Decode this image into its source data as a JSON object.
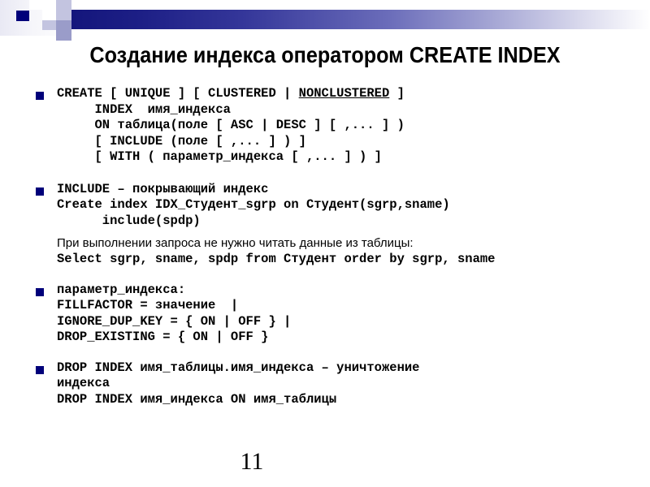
{
  "slide": {
    "title": "Создание индекса оператором CREATE INDEX",
    "page_number": "11",
    "accent_color": "#00007a",
    "bar_color_start": "#14167c",
    "bar_color_end": "#ffffff"
  },
  "blocks": {
    "create": {
      "line1_pre": "CREATE [ UNIQUE ] [ CLUSTERED | ",
      "line1_underlined": "NONCLUSTERED",
      "line1_post": " ]",
      "line2": "     INDEX  имя_индекса",
      "line3": "     ON таблица(поле [ ASC | DESC ] [ ,... ] )",
      "line4": "     [ INCLUDE (поле [ ,... ] ) ]",
      "line5": "     [ WITH ( параметр_индекса [ ,... ] ) ]"
    },
    "include": {
      "line1": "INCLUDE – покрывающий индекс",
      "line2": "Create index IDX_Студент_sgrp on Студент(sgrp,sname)",
      "line3": "      include(spdp)",
      "note": "При выполнении запроса не нужно читать данные из таблицы:",
      "line4": "Select sgrp, sname, spdp from Студент order by sgrp, sname"
    },
    "params": {
      "line1": "параметр_индекса:",
      "line2": "FILLFACTOR = значение  |",
      "line3": "IGNORE_DUP_KEY = { ON | OFF } |",
      "line4": "DROP_EXISTING = { ON | OFF }"
    },
    "drop": {
      "line1": "DROP INDEX имя_таблицы.имя_индекса – уничтожение",
      "line2": "индекса",
      "line3": "DROP INDEX имя_индекса ON имя_таблицы"
    }
  }
}
